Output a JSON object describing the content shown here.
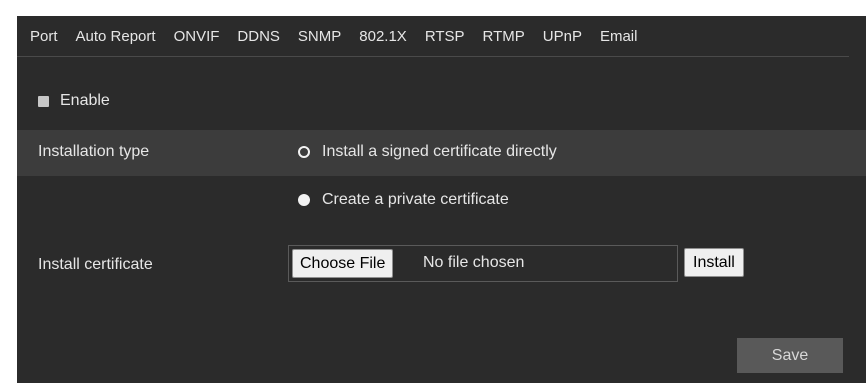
{
  "tabs": [
    {
      "label": "Port"
    },
    {
      "label": "Auto Report"
    },
    {
      "label": "ONVIF"
    },
    {
      "label": "DDNS"
    },
    {
      "label": "SNMP"
    },
    {
      "label": "802.1X"
    },
    {
      "label": "RTSP"
    },
    {
      "label": "RTMP"
    },
    {
      "label": "UPnP"
    },
    {
      "label": "Email"
    }
  ],
  "enable": {
    "label": "Enable",
    "checked": false
  },
  "installation_type": {
    "label": "Installation type",
    "options": [
      {
        "label": "Install a signed certificate directly",
        "selected": true
      },
      {
        "label": "Create a private certificate",
        "selected": false
      }
    ]
  },
  "install_certificate": {
    "label": "Install certificate",
    "choose_file_label": "Choose File",
    "file_status": "No file chosen",
    "install_label": "Install"
  },
  "save_label": "Save",
  "colors": {
    "panel_background": "#2b2b2b",
    "highlight_row": "#3c3c3c",
    "save_button": "#595959"
  }
}
